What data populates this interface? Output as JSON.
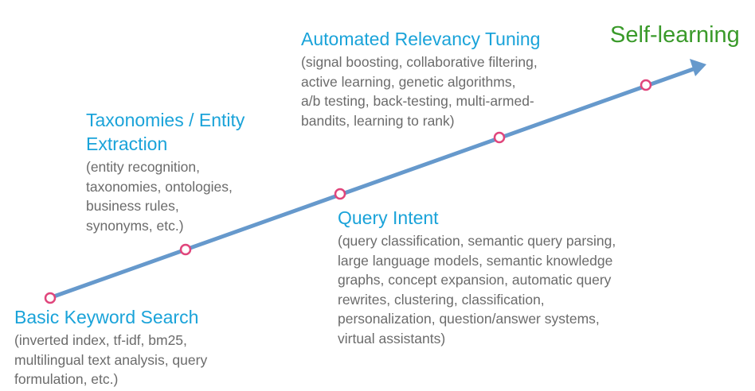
{
  "colors": {
    "arrow": "#6699cc",
    "milestone_marker_stroke": "#e0457b",
    "milestone_marker_fill": "#ffffff",
    "stage_title": "#1aa3d9",
    "stage_description": "#6b6b6b",
    "endpoint_label": "#3a9a2a"
  },
  "endpoint": {
    "label": "Self-learning"
  },
  "stages": [
    {
      "title": "Basic Keyword Search",
      "description_lines": [
        "(inverted index, tf-idf, bm25,",
        "multilingual text analysis, query",
        "formulation, etc.)"
      ]
    },
    {
      "title_lines": [
        "Taxonomies / Entity",
        "Extraction"
      ],
      "description_lines": [
        "(entity recognition,",
        "taxonomies, ontologies,",
        "business rules,",
        "synonyms, etc.)"
      ]
    },
    {
      "title": "Query Intent",
      "description_lines": [
        "(query classification, semantic query parsing,",
        "large language models, semantic knowledge",
        "graphs, concept expansion, automatic query",
        "rewrites, clustering, classification,",
        "personalization, question/answer systems,",
        "virtual assistants)"
      ]
    },
    {
      "title": "Automated Relevancy Tuning",
      "description_lines": [
        "(signal boosting, collaborative filtering,",
        "active learning, genetic algorithms,",
        "a/b testing, back-testing, multi-armed-",
        "bandits, learning to rank)"
      ]
    }
  ]
}
